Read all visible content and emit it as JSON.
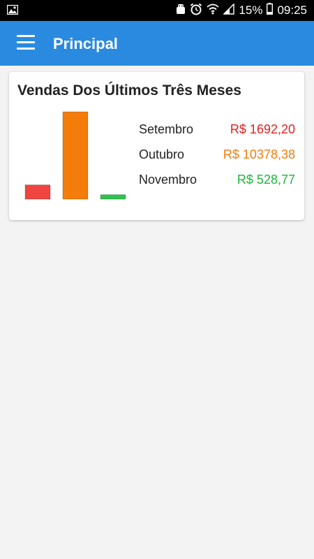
{
  "status_bar": {
    "battery": "15%",
    "time": "09:25"
  },
  "app_bar": {
    "title": "Principal",
    "menu_icon": "hamburger-menu-icon"
  },
  "card": {
    "title": "Vendas Dos Últimos Três Meses",
    "rows": [
      {
        "month": "Setembro",
        "value": "R$ 1692,20",
        "color": "#e0211d"
      },
      {
        "month": "Outubro",
        "value": "R$ 10378,38",
        "color": "#f47c0b"
      },
      {
        "month": "Novembro",
        "value": "R$ 528,77",
        "color": "#1fb53a"
      }
    ]
  },
  "chart_data": {
    "type": "bar",
    "categories": [
      "Setembro",
      "Outubro",
      "Novembro"
    ],
    "values": [
      1692.2,
      10378.38,
      528.77
    ],
    "colors": [
      "#f0443f",
      "#f47c0b",
      "#2cc44a"
    ],
    "title": "Vendas Dos Últimos Três Meses",
    "xlabel": "",
    "ylabel": "",
    "ylim": [
      0,
      10378.38
    ],
    "grid": false
  }
}
